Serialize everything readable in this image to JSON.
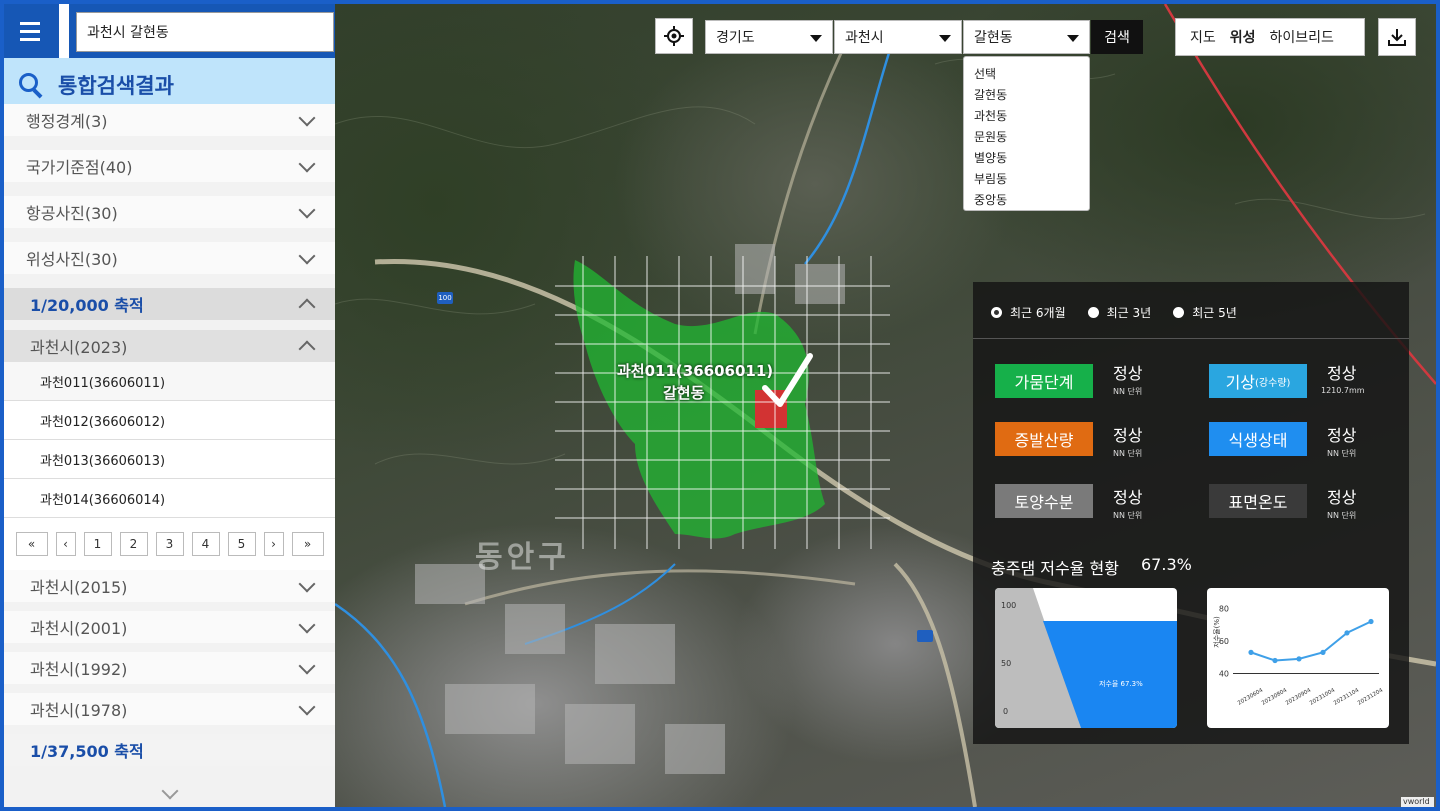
{
  "search": {
    "value": "과천시 갈현동",
    "button": "검 색"
  },
  "results": {
    "title": "통합검색결과",
    "categories": [
      "행정경계(3)",
      "국가기준점(40)",
      "항공사진(30)",
      "위성사진(30)"
    ],
    "scale_1": "1/20,000 축적",
    "group_2023": "과천시(2023)",
    "items": [
      "과천011(36606011)",
      "과천012(36606012)",
      "과천013(36606013)",
      "과천014(36606014)"
    ],
    "pager": [
      "«",
      "‹",
      "1",
      "2",
      "3",
      "4",
      "5",
      "›",
      "»"
    ],
    "older": [
      "과천시(2015)",
      "과천시(2001)",
      "과천시(1992)",
      "과천시(1978)"
    ],
    "scale_2": "1/37,500 축적"
  },
  "toggle": {
    "close": "×",
    "next": "›"
  },
  "filters": {
    "province": "경기도",
    "city": "과천시",
    "dong": "갈현동",
    "go": "검색",
    "dong_options": [
      "선택",
      "갈현동",
      "과천동",
      "문원동",
      "별양동",
      "부림동",
      "중앙동"
    ]
  },
  "map_type": {
    "options": [
      "지도",
      "위성",
      "하이브리드"
    ],
    "selected": "위성"
  },
  "map": {
    "region_label_1": "과천011(36606011)",
    "region_label_2": "갈현동",
    "district_label": "동안구",
    "highway_badge": "100",
    "credit": "vworld"
  },
  "dashboard": {
    "periods": [
      "최근 6개월",
      "최근 3년",
      "최근 5년"
    ],
    "selected_period": "최근 6개월",
    "metrics": [
      {
        "name": "가뭄단계",
        "status": "정상",
        "unit": "NN 단위",
        "color": "#16b04a"
      },
      {
        "name": "기상",
        "name_sub": "(강수량)",
        "status": "정상",
        "unit": "1210.7mm",
        "color": "#2aa6e0"
      },
      {
        "name": "증발산량",
        "status": "정상",
        "unit": "NN 단위",
        "color": "#e06b12"
      },
      {
        "name": "식생상태",
        "status": "정상",
        "unit": "NN 단위",
        "color": "#1f8ef0"
      },
      {
        "name": "토양수분",
        "status": "정상",
        "unit": "NN 단위",
        "color": "#7a7a7a"
      },
      {
        "name": "표면온도",
        "status": "정상",
        "unit": "NN 단위",
        "color": "#3a3a3a"
      }
    ],
    "dam_title": "충주댐 저수율 현황",
    "dam_pct": "67.3%",
    "gauge_label": "저수율 67.3%",
    "gauge_ticks": [
      "100",
      "50",
      "0"
    ],
    "gauge_value": 67.3
  },
  "chart_data": {
    "type": "line",
    "ylabel": "저수율(%)",
    "x": [
      "20230604",
      "20230804",
      "20230904",
      "20231004",
      "20231104",
      "20231204"
    ],
    "values": [
      53,
      48,
      49,
      53,
      65,
      72
    ],
    "yticks": [
      40,
      60,
      80
    ],
    "ylim": [
      36,
      84
    ],
    "color": "#3fa0e8"
  }
}
